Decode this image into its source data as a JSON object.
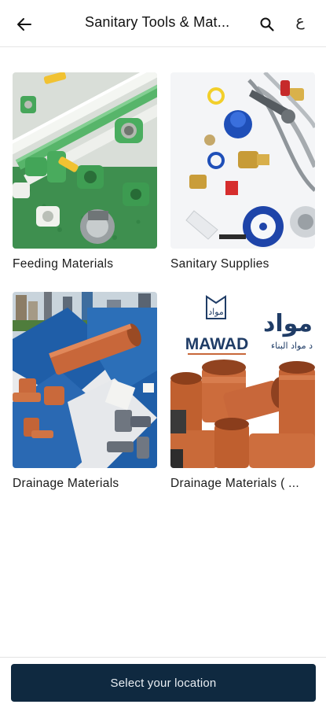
{
  "header": {
    "title": "Sanitary Tools & Mat...",
    "lang_label": "ع"
  },
  "icons": {
    "back": "arrow-left-icon",
    "search": "search-icon"
  },
  "categories": [
    {
      "label": "Feeding Materials"
    },
    {
      "label": "Sanitary Supplies"
    },
    {
      "label": "Drainage Materials"
    },
    {
      "label": "Drainage Materials ( ..."
    }
  ],
  "mawad": {
    "brand": "MAWAD",
    "arabic_logo": "مواد",
    "arabic_side": "مواد",
    "arabic_tagline": "د مواد البناء"
  },
  "footer": {
    "location_button": "Select your location"
  },
  "colors": {
    "primary": "#0f2940",
    "pipe_orange": "#c8673a",
    "pipe_green": "#3aa35a",
    "panel_blue": "#2c6fb8"
  }
}
